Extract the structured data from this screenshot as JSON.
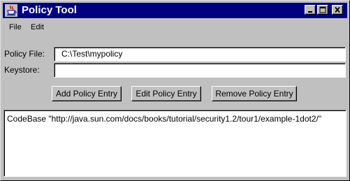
{
  "window": {
    "title": "Policy Tool",
    "title_bar_color": "#000080",
    "background_color": "#c0c0c0",
    "icons": [
      "java-cup-icon",
      "minimize-icon",
      "maximize-icon",
      "close-icon"
    ]
  },
  "menu": {
    "file_label": "File",
    "edit_label": "Edit"
  },
  "form": {
    "policy_file_label": "Policy File:",
    "policy_file_value": "C:\\Test\\mypolicy",
    "keystore_label": "Keystore:",
    "keystore_value": ""
  },
  "buttons": {
    "add_label": "Add Policy Entry",
    "edit_label": "Edit Policy Entry",
    "remove_label": "Remove Policy Entry"
  },
  "entries": [
    {
      "text": "CodeBase \"http://java.sun.com/docs/books/tutorial/security1.2/tour1/example-1dot2/\""
    }
  ]
}
